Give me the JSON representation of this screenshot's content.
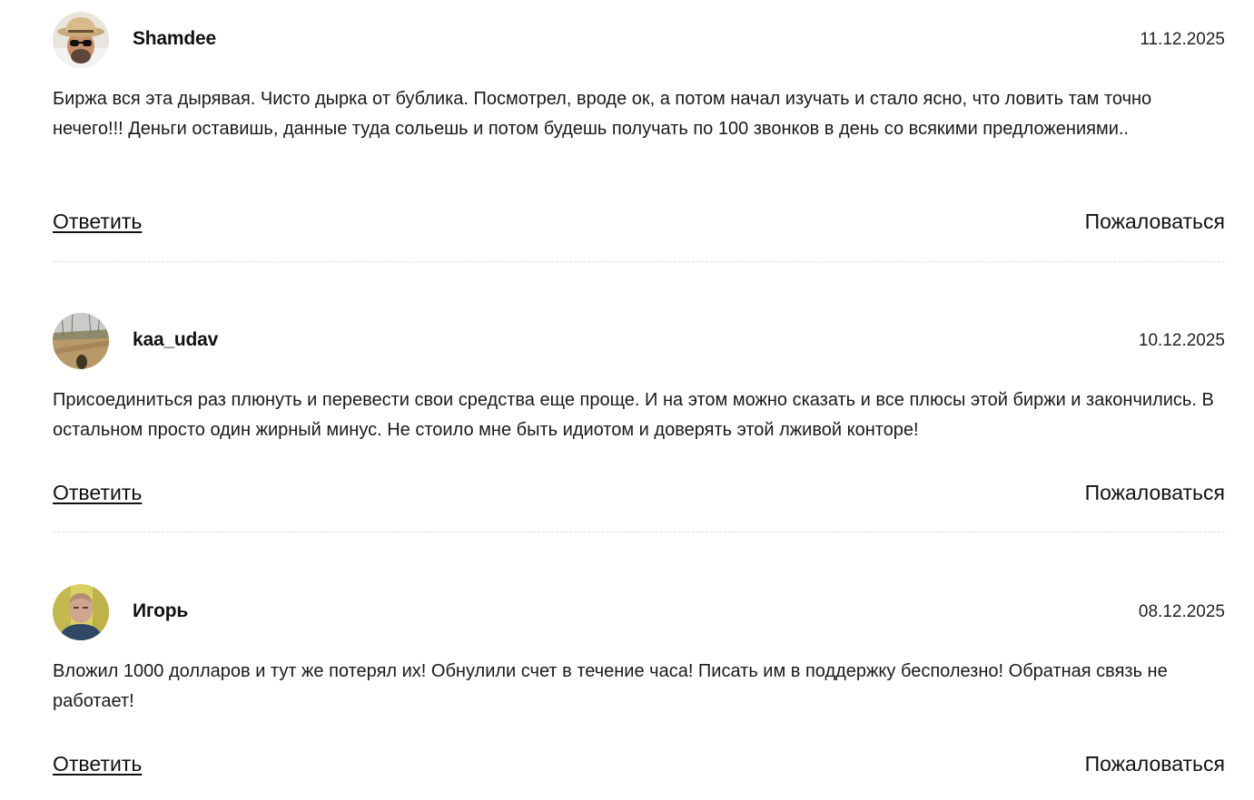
{
  "comments": [
    {
      "author": "Shamdee",
      "date": "11.12.2025",
      "text": "Биржа вся эта дырявая. Чисто дырка от бублика. Посмотрел, вроде ок, а потом начал изучать и стало ясно, что ловить там точно нечего!!! Деньги оставишь, данные туда сольешь и потом будешь получать по 100 звонков в день со всякими предложениями..",
      "reply_label": "Ответить",
      "report_label": "Пожаловаться",
      "avatar_icon": "avatar-man-hat-sunglasses"
    },
    {
      "author": "kaa_udav",
      "date": "10.12.2025",
      "text": "Присоединиться раз плюнуть и перевести свои средства еще проще. И на этом можно сказать и все плюсы этой биржи и закончились. В остальном просто один жирный минус. Не стоило мне быть идиотом и доверять этой лживой конторе!",
      "reply_label": "Ответить",
      "report_label": "Пожаловаться",
      "avatar_icon": "avatar-landscape-shadow"
    },
    {
      "author": "Игорь",
      "date": "08.12.2025",
      "text": "Вложил 1000 долларов и тут же потерял их! Обнулили счет в течение часа! Писать им в поддержку бесполезно! Обратная связь не работает!",
      "reply_label": "Ответить",
      "report_label": "Пожаловаться",
      "avatar_icon": "avatar-man-portrait"
    }
  ]
}
